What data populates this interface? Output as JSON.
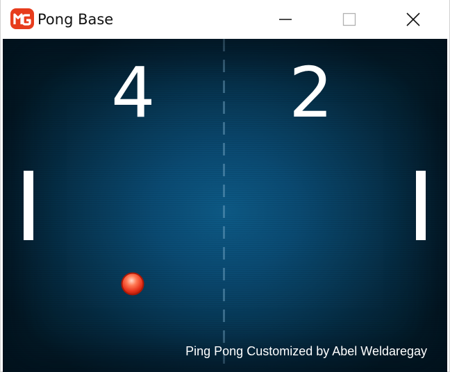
{
  "window": {
    "title": "Pong Base",
    "app_icon": "monogame-logo-icon",
    "controls": {
      "minimize": "minimize-icon",
      "maximize": "maximize-icon",
      "close": "close-icon"
    }
  },
  "game": {
    "score_left": "4",
    "score_right": "2",
    "credit_text": "Ping Pong Customized by Abel Weldaregay",
    "colors": {
      "background_center": "#0d5a86",
      "background_edge": "#031b28",
      "paddle": "#ffffff",
      "ball": "#e8341c",
      "center_line": "#78aac8"
    }
  }
}
